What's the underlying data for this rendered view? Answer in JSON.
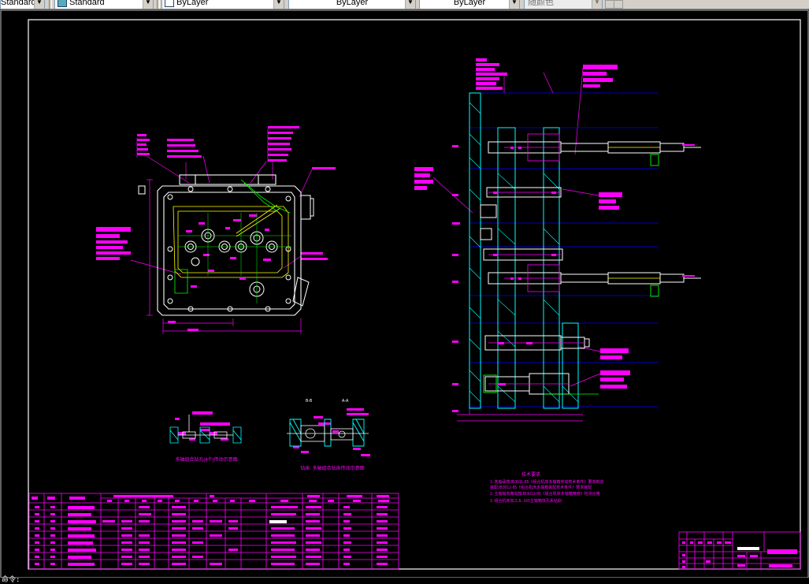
{
  "toolbar": {
    "textstyle": "Standard",
    "layer": "ByLayer",
    "linetype": "ByLayer",
    "lineweight": "ByLayer",
    "plotstyle": "随颜色"
  },
  "drawing": {
    "note_left": "多轴组合钻孔(4个)传动示意图",
    "note_right": "钻床: 多轴组合钻床传动示意图",
    "tech_title": "技术要求",
    "tech_lines": [
      "1. 各轴承按JB3011-85《组合机床多轴箱传动技术条件》要求制造",
      "   装配JB3012-85《组合机床多轴箱装配技术条件》要求装配",
      "2. 主轴轴向窜动按JB3013-85《组合机床多轴箱精度》检测合格",
      "3. 组合机床加工JL-165主轴箱体孔系钻削"
    ],
    "section_a": "A-A",
    "section_b": "B-B"
  },
  "colors": {
    "background": "#000000",
    "frame": "#ffffff",
    "geometry": "#ffffff",
    "label_fill": "#ff00ff",
    "dimension": "#ff00ff",
    "hatch": "#00ffff",
    "section": "#00ff00",
    "centerline": "#0000ff",
    "highlight": "#ffff00"
  },
  "status": {
    "command": "命令:"
  }
}
